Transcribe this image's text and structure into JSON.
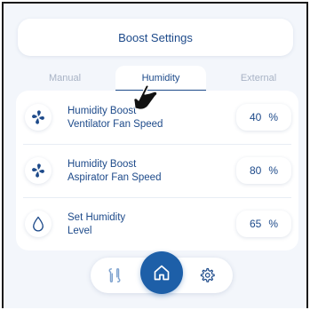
{
  "header": {
    "title": "Boost Settings"
  },
  "tabs": [
    {
      "label": "Manual"
    },
    {
      "label": "Humidity"
    },
    {
      "label": "External"
    }
  ],
  "rows": [
    {
      "icon": "fan-icon",
      "line1": "Humidity Boost",
      "line2": "Ventilator Fan Speed",
      "value": "40",
      "unit": "%"
    },
    {
      "icon": "fan-icon",
      "line1": "Humidity Boost",
      "line2": "Aspirator Fan Speed",
      "value": "80",
      "unit": "%"
    },
    {
      "icon": "water-drop-icon",
      "line1": "Set Humidity",
      "line2": "Level",
      "value": "65",
      "unit": "%"
    }
  ],
  "nav": {
    "left_icon": "connection-icon",
    "center_icon": "home-icon",
    "right_icon": "gear-icon"
  },
  "colors": {
    "primary": "#1d4a8a",
    "accent": "#1d5fa8",
    "muted": "#a8b3c5",
    "background": "#f3f6fb"
  }
}
